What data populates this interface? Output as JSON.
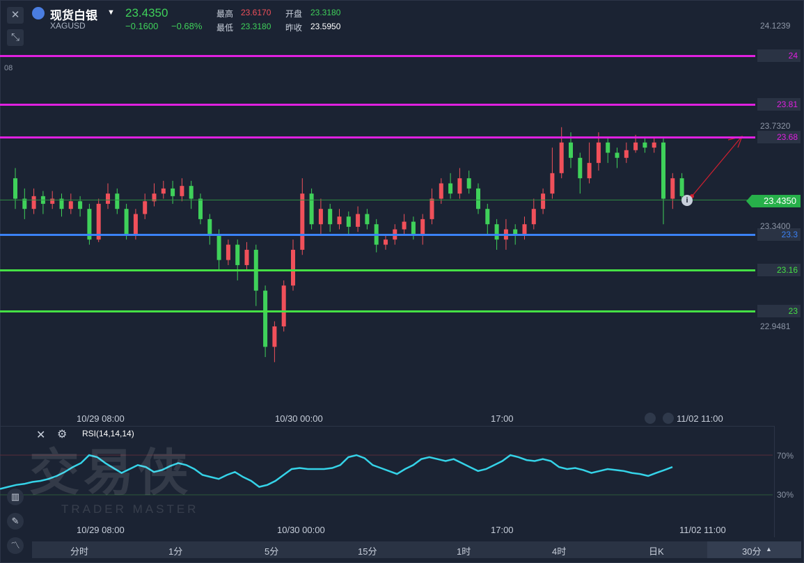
{
  "header": {
    "name": "现货白银",
    "symbol": "XAGUSD",
    "price": "23.4350",
    "change": "−0.1600",
    "change_pct": "−0.68%",
    "high_label": "最高",
    "high": "23.6170",
    "open_label": "开盘",
    "open": "23.3180",
    "low_label": "最低",
    "low": "23.3180",
    "prev_label": "昨收",
    "prev": "23.5950"
  },
  "levels": [
    {
      "value": 24,
      "label": "24",
      "color": "#e020e0"
    },
    {
      "value": 23.81,
      "label": "23.81",
      "color": "#e020e0"
    },
    {
      "value": 23.68,
      "label": "23.68",
      "color": "#e020e0"
    },
    {
      "value": 23.3,
      "label": "23.3",
      "color": "#3b82f6"
    },
    {
      "value": 23.16,
      "label": "23.16",
      "color": "#45e045"
    },
    {
      "value": 23.0,
      "label": "23",
      "color": "#45e045"
    }
  ],
  "price_axis": {
    "top": "24.1239",
    "upper": "23.7320",
    "mid": "23.3400",
    "bottom": "22.9481",
    "edge": "08"
  },
  "current_price": "23.4350",
  "time_labels": {
    "t1": "10/29 08:00",
    "t2": "10/30 00:00",
    "t3": "17:00",
    "t4": "11/02 11:00"
  },
  "indicator": {
    "name": "RSI(14,14,14)",
    "upper": "70%",
    "lower": "30%"
  },
  "periods": [
    "分时",
    "1分",
    "5分",
    "15分",
    "1时",
    "4时",
    "日K",
    "30分"
  ],
  "active_period": "30分",
  "watermark": {
    "cn": "交易侠",
    "en": "TRADER MASTER"
  },
  "colors": {
    "up": "#f0505a",
    "down": "#3fd15a",
    "rsi": "#35d3e8"
  },
  "chart_data": {
    "type": "candlestick",
    "candles": [
      [
        23.52,
        23.44,
        23.56,
        23.4
      ],
      [
        23.44,
        23.4,
        23.48,
        23.36
      ],
      [
        23.4,
        23.45,
        23.48,
        23.38
      ],
      [
        23.45,
        23.42,
        23.47,
        23.38
      ],
      [
        23.42,
        23.44,
        23.47,
        23.4
      ],
      [
        23.44,
        23.4,
        23.46,
        23.37
      ],
      [
        23.4,
        23.43,
        23.46,
        23.38
      ],
      [
        23.43,
        23.4,
        23.45,
        23.37
      ],
      [
        23.4,
        23.28,
        23.42,
        23.26
      ],
      [
        23.28,
        23.42,
        23.44,
        23.27
      ],
      [
        23.42,
        23.46,
        23.5,
        23.4
      ],
      [
        23.46,
        23.4,
        23.48,
        23.38
      ],
      [
        23.4,
        23.3,
        23.42,
        23.28
      ],
      [
        23.3,
        23.38,
        23.4,
        23.28
      ],
      [
        23.38,
        23.43,
        23.46,
        23.36
      ],
      [
        23.43,
        23.46,
        23.5,
        23.41
      ],
      [
        23.46,
        23.48,
        23.51,
        23.44
      ],
      [
        23.48,
        23.45,
        23.51,
        23.42
      ],
      [
        23.45,
        23.49,
        23.52,
        23.43
      ],
      [
        23.49,
        23.44,
        23.51,
        23.4
      ],
      [
        23.44,
        23.36,
        23.46,
        23.34
      ],
      [
        23.36,
        23.3,
        23.38,
        23.26
      ],
      [
        23.3,
        23.2,
        23.32,
        23.16
      ],
      [
        23.2,
        23.26,
        23.28,
        23.18
      ],
      [
        23.26,
        23.18,
        23.28,
        23.12
      ],
      [
        23.18,
        23.24,
        23.27,
        23.16
      ],
      [
        23.24,
        23.08,
        23.26,
        23.02
      ],
      [
        23.08,
        22.86,
        23.1,
        22.82
      ],
      [
        22.86,
        22.94,
        22.96,
        22.8
      ],
      [
        22.94,
        23.1,
        23.12,
        22.92
      ],
      [
        23.1,
        23.24,
        23.28,
        23.08
      ],
      [
        23.24,
        23.46,
        23.52,
        23.22
      ],
      [
        23.46,
        23.34,
        23.48,
        23.32
      ],
      [
        23.34,
        23.4,
        23.44,
        23.3
      ],
      [
        23.4,
        23.34,
        23.42,
        23.31
      ],
      [
        23.34,
        23.37,
        23.4,
        23.32
      ],
      [
        23.37,
        23.33,
        23.39,
        23.3
      ],
      [
        23.33,
        23.38,
        23.41,
        23.31
      ],
      [
        23.38,
        23.34,
        23.4,
        23.32
      ],
      [
        23.34,
        23.26,
        23.36,
        23.23
      ],
      [
        23.26,
        23.28,
        23.3,
        23.24
      ],
      [
        23.28,
        23.32,
        23.34,
        23.26
      ],
      [
        23.32,
        23.35,
        23.38,
        23.3
      ],
      [
        23.35,
        23.3,
        23.37,
        23.28
      ],
      [
        23.3,
        23.36,
        23.38,
        23.26
      ],
      [
        23.36,
        23.44,
        23.48,
        23.34
      ],
      [
        23.44,
        23.5,
        23.52,
        23.42
      ],
      [
        23.5,
        23.46,
        23.54,
        23.44
      ],
      [
        23.46,
        23.52,
        23.56,
        23.44
      ],
      [
        23.52,
        23.48,
        23.55,
        23.46
      ],
      [
        23.48,
        23.4,
        23.5,
        23.38
      ],
      [
        23.4,
        23.34,
        23.42,
        23.3
      ],
      [
        23.34,
        23.28,
        23.36,
        23.24
      ],
      [
        23.28,
        23.32,
        23.36,
        23.24
      ],
      [
        23.32,
        23.3,
        23.34,
        23.26
      ],
      [
        23.3,
        23.34,
        23.37,
        23.28
      ],
      [
        23.34,
        23.4,
        23.44,
        23.32
      ],
      [
        23.4,
        23.46,
        23.48,
        23.38
      ],
      [
        23.46,
        23.54,
        23.64,
        23.44
      ],
      [
        23.54,
        23.66,
        23.72,
        23.52
      ],
      [
        23.66,
        23.6,
        23.7,
        23.56
      ],
      [
        23.6,
        23.52,
        23.62,
        23.46
      ],
      [
        23.52,
        23.58,
        23.66,
        23.5
      ],
      [
        23.58,
        23.66,
        23.7,
        23.55
      ],
      [
        23.66,
        23.62,
        23.68,
        23.58
      ],
      [
        23.62,
        23.6,
        23.64,
        23.56
      ],
      [
        23.6,
        23.63,
        23.66,
        23.58
      ],
      [
        23.63,
        23.66,
        23.69,
        23.62
      ],
      [
        23.66,
        23.64,
        23.68,
        23.62
      ],
      [
        23.64,
        23.66,
        23.68,
        23.62
      ],
      [
        23.66,
        23.44,
        23.68,
        23.34
      ],
      [
        23.44,
        23.52,
        23.54,
        23.4
      ],
      [
        23.52,
        23.45,
        23.54,
        23.43
      ]
    ],
    "rsi": [
      36,
      38,
      40,
      41,
      43,
      44,
      46,
      49,
      53,
      58,
      62,
      70,
      68,
      62,
      57,
      52,
      56,
      60,
      58,
      53,
      55,
      59,
      62,
      60,
      56,
      50,
      48,
      46,
      50,
      53,
      48,
      44,
      38,
      40,
      44,
      50,
      56,
      57,
      56,
      56,
      56,
      57,
      60,
      68,
      70,
      67,
      60,
      57,
      54,
      51,
      56,
      60,
      66,
      68,
      66,
      64,
      66,
      62,
      58,
      54,
      56,
      60,
      64,
      70,
      68,
      65,
      64,
      66,
      64,
      58,
      56,
      57,
      55,
      52,
      54,
      56,
      55,
      54,
      52,
      51,
      49,
      52,
      55,
      58
    ],
    "levels": [
      24,
      23.81,
      23.68,
      23.3,
      23.16,
      23.0
    ],
    "ylim": [
      22.84,
      24.22
    ],
    "rsi_ylim": [
      0,
      100
    ]
  }
}
